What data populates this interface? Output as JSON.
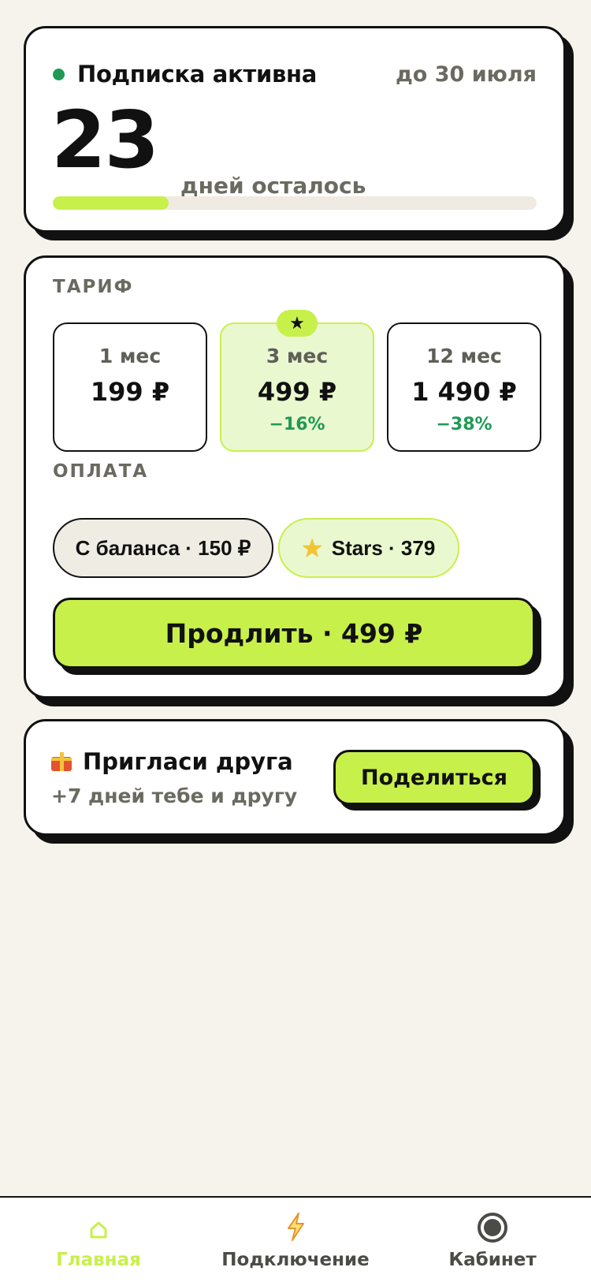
{
  "subscription": {
    "status_label": "Подписка активна",
    "until": "до 30 июля",
    "days_left": "23",
    "days_label": "дней осталось",
    "progress_fraction": 0.24,
    "status_color": "#1f9a55"
  },
  "tariff": {
    "section_label": "ТАРИФ",
    "plans": [
      {
        "duration": "1 мес",
        "price": "199 ₽",
        "discount": ""
      },
      {
        "duration": "3 мес",
        "price": "499 ₽",
        "discount": "−16%",
        "selected": true,
        "badge": "★"
      },
      {
        "duration": "12 мес",
        "price": "1 490 ₽",
        "discount": "−38%"
      }
    ]
  },
  "payment": {
    "section_label": "ОПЛАТА",
    "balance_label": "С баланса · 150 ₽",
    "stars_label": "Stars · 379",
    "stars_icon": "star-icon"
  },
  "renew_button": "Продлить · 499 ₽",
  "invite": {
    "icon": "gift-icon",
    "title": "Пригласи друга",
    "subtitle": "+7 дней тебе и другу",
    "share_button": "Поделиться"
  },
  "nav": {
    "items": [
      {
        "label": "Главная",
        "icon": "home-icon",
        "active": true
      },
      {
        "label": "Подключение",
        "icon": "lightning-icon"
      },
      {
        "label": "Кабинет",
        "icon": "profile-icon"
      }
    ]
  },
  "colors": {
    "accent": "#c8f04b",
    "accent_light": "#eaf8cf",
    "background": "#f6f3ec",
    "discount": "#1f9a55"
  }
}
